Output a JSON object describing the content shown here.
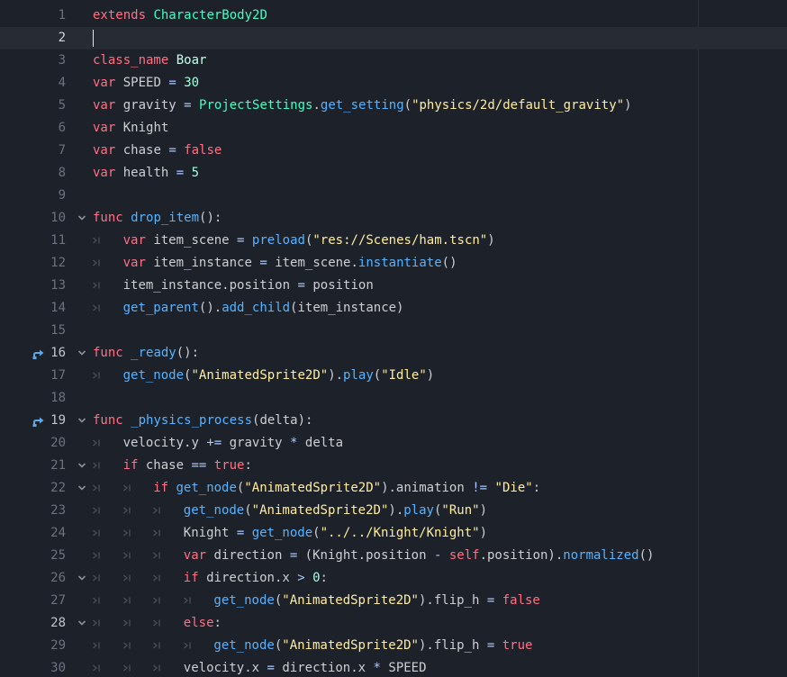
{
  "editor": {
    "current_line": 2,
    "line_numbers": [
      "1",
      "2",
      "3",
      "4",
      "5",
      "6",
      "7",
      "8",
      "9",
      "10",
      "11",
      "12",
      "13",
      "14",
      "15",
      "16",
      "17",
      "18",
      "19",
      "20",
      "21",
      "22",
      "23",
      "24",
      "25",
      "26",
      "27",
      "28",
      "29",
      "30"
    ],
    "lines": [
      {
        "indent": 0,
        "tokens": [
          [
            "kw",
            "extends"
          ],
          [
            "pl",
            " "
          ],
          [
            "ty",
            "CharacterBody2D"
          ]
        ]
      },
      {
        "indent": 0,
        "tokens": []
      },
      {
        "indent": 0,
        "tokens": [
          [
            "kw",
            "class_name"
          ],
          [
            "pl",
            " "
          ],
          [
            "cls",
            "Boar"
          ]
        ]
      },
      {
        "indent": 0,
        "tokens": [
          [
            "kw",
            "var"
          ],
          [
            "pl",
            " SPEED "
          ],
          [
            "op",
            "="
          ],
          [
            "pl",
            " "
          ],
          [
            "nu",
            "30"
          ]
        ]
      },
      {
        "indent": 0,
        "tokens": [
          [
            "kw",
            "var"
          ],
          [
            "pl",
            " gravity "
          ],
          [
            "op",
            "="
          ],
          [
            "pl",
            " "
          ],
          [
            "ty",
            "ProjectSettings"
          ],
          [
            "pl",
            "."
          ],
          [
            "fn",
            "get_setting"
          ],
          [
            "pl",
            "("
          ],
          [
            "st",
            "\"physics/2d/default_gravity\""
          ],
          [
            "pl",
            ")"
          ]
        ]
      },
      {
        "indent": 0,
        "tokens": [
          [
            "kw",
            "var"
          ],
          [
            "pl",
            " Knight"
          ]
        ]
      },
      {
        "indent": 0,
        "tokens": [
          [
            "kw",
            "var"
          ],
          [
            "pl",
            " chase "
          ],
          [
            "op",
            "="
          ],
          [
            "pl",
            " "
          ],
          [
            "kw",
            "false"
          ]
        ]
      },
      {
        "indent": 0,
        "tokens": [
          [
            "kw",
            "var"
          ],
          [
            "pl",
            " health "
          ],
          [
            "op",
            "="
          ],
          [
            "pl",
            " "
          ],
          [
            "nu",
            "5"
          ]
        ]
      },
      {
        "indent": 0,
        "tokens": []
      },
      {
        "indent": 0,
        "tokens": [
          [
            "kw",
            "func"
          ],
          [
            "pl",
            " "
          ],
          [
            "fn",
            "drop_item"
          ],
          [
            "pl",
            "():"
          ]
        ]
      },
      {
        "indent": 1,
        "tokens": [
          [
            "kw",
            "var"
          ],
          [
            "pl",
            " item_scene "
          ],
          [
            "op",
            "="
          ],
          [
            "pl",
            " "
          ],
          [
            "fn",
            "preload"
          ],
          [
            "pl",
            "("
          ],
          [
            "st",
            "\"res://Scenes/ham.tscn\""
          ],
          [
            "pl",
            ")"
          ]
        ]
      },
      {
        "indent": 1,
        "tokens": [
          [
            "kw",
            "var"
          ],
          [
            "pl",
            " item_instance "
          ],
          [
            "op",
            "="
          ],
          [
            "pl",
            " item_scene."
          ],
          [
            "fn",
            "instantiate"
          ],
          [
            "pl",
            "()"
          ]
        ]
      },
      {
        "indent": 1,
        "tokens": [
          [
            "pl",
            "item_instance.position "
          ],
          [
            "op",
            "="
          ],
          [
            "pl",
            " position"
          ]
        ]
      },
      {
        "indent": 1,
        "tokens": [
          [
            "fn",
            "get_parent"
          ],
          [
            "pl",
            "()."
          ],
          [
            "fn",
            "add_child"
          ],
          [
            "pl",
            "(item_instance)"
          ]
        ]
      },
      {
        "indent": 0,
        "tokens": []
      },
      {
        "indent": 0,
        "tokens": [
          [
            "kw",
            "func"
          ],
          [
            "pl",
            " "
          ],
          [
            "fn",
            "_ready"
          ],
          [
            "pl",
            "():"
          ]
        ]
      },
      {
        "indent": 1,
        "tokens": [
          [
            "fn",
            "get_node"
          ],
          [
            "pl",
            "("
          ],
          [
            "st",
            "\"AnimatedSprite2D\""
          ],
          [
            "pl",
            ")."
          ],
          [
            "fn",
            "play"
          ],
          [
            "pl",
            "("
          ],
          [
            "st",
            "\"Idle\""
          ],
          [
            "pl",
            ")"
          ]
        ]
      },
      {
        "indent": 0,
        "tokens": []
      },
      {
        "indent": 0,
        "tokens": [
          [
            "kw",
            "func"
          ],
          [
            "pl",
            " "
          ],
          [
            "fn",
            "_physics_process"
          ],
          [
            "pl",
            "(delta):"
          ]
        ]
      },
      {
        "indent": 1,
        "tokens": [
          [
            "pl",
            "velocity.y "
          ],
          [
            "op",
            "+="
          ],
          [
            "pl",
            " gravity "
          ],
          [
            "op",
            "*"
          ],
          [
            "pl",
            " delta"
          ]
        ]
      },
      {
        "indent": 1,
        "tokens": [
          [
            "kw",
            "if"
          ],
          [
            "pl",
            " chase "
          ],
          [
            "op",
            "=="
          ],
          [
            "pl",
            " "
          ],
          [
            "kw",
            "true"
          ],
          [
            "pl",
            ":"
          ]
        ]
      },
      {
        "indent": 2,
        "tokens": [
          [
            "kw",
            "if"
          ],
          [
            "pl",
            " "
          ],
          [
            "fn",
            "get_node"
          ],
          [
            "pl",
            "("
          ],
          [
            "st",
            "\"AnimatedSprite2D\""
          ],
          [
            "pl",
            ").animation "
          ],
          [
            "op",
            "!="
          ],
          [
            "pl",
            " "
          ],
          [
            "st",
            "\"Die\""
          ],
          [
            "pl",
            ":"
          ]
        ]
      },
      {
        "indent": 3,
        "tokens": [
          [
            "fn",
            "get_node"
          ],
          [
            "pl",
            "("
          ],
          [
            "st",
            "\"AnimatedSprite2D\""
          ],
          [
            "pl",
            ")."
          ],
          [
            "fn",
            "play"
          ],
          [
            "pl",
            "("
          ],
          [
            "st",
            "\"Run\""
          ],
          [
            "pl",
            ")"
          ]
        ]
      },
      {
        "indent": 3,
        "tokens": [
          [
            "pl",
            "Knight "
          ],
          [
            "op",
            "="
          ],
          [
            "pl",
            " "
          ],
          [
            "fn",
            "get_node"
          ],
          [
            "pl",
            "("
          ],
          [
            "st",
            "\"../../Knight/Knight\""
          ],
          [
            "pl",
            ")"
          ]
        ]
      },
      {
        "indent": 3,
        "tokens": [
          [
            "kw",
            "var"
          ],
          [
            "pl",
            " direction "
          ],
          [
            "op",
            "="
          ],
          [
            "pl",
            " (Knight.position "
          ],
          [
            "op",
            "-"
          ],
          [
            "pl",
            " "
          ],
          [
            "kw",
            "self"
          ],
          [
            "pl",
            ".position)."
          ],
          [
            "fn",
            "normalized"
          ],
          [
            "pl",
            "()"
          ]
        ]
      },
      {
        "indent": 3,
        "tokens": [
          [
            "kw",
            "if"
          ],
          [
            "pl",
            " direction.x "
          ],
          [
            "op",
            ">"
          ],
          [
            "pl",
            " "
          ],
          [
            "nu",
            "0"
          ],
          [
            "pl",
            ":"
          ]
        ]
      },
      {
        "indent": 4,
        "tokens": [
          [
            "fn",
            "get_node"
          ],
          [
            "pl",
            "("
          ],
          [
            "st",
            "\"AnimatedSprite2D\""
          ],
          [
            "pl",
            ").flip_h "
          ],
          [
            "op",
            "="
          ],
          [
            "pl",
            " "
          ],
          [
            "kw",
            "false"
          ]
        ]
      },
      {
        "indent": 3,
        "tokens": [
          [
            "kw",
            "else"
          ],
          [
            "pl",
            ":"
          ]
        ]
      },
      {
        "indent": 4,
        "tokens": [
          [
            "fn",
            "get_node"
          ],
          [
            "pl",
            "("
          ],
          [
            "st",
            "\"AnimatedSprite2D\""
          ],
          [
            "pl",
            ").flip_h "
          ],
          [
            "op",
            "="
          ],
          [
            "pl",
            " "
          ],
          [
            "kw",
            "true"
          ]
        ]
      },
      {
        "indent": 3,
        "tokens": [
          [
            "pl",
            "velocity.x "
          ],
          [
            "op",
            "="
          ],
          [
            "pl",
            " direction.x "
          ],
          [
            "op",
            "*"
          ],
          [
            "pl",
            " SPEED"
          ]
        ]
      }
    ],
    "fold_lines": [
      10,
      16,
      19,
      21,
      22,
      26,
      28
    ],
    "override_lines": [
      16,
      19
    ],
    "bright_number_lines": [
      16,
      19,
      28
    ],
    "icons": {
      "fold": "chevron-down-icon",
      "override": "method-override-icon",
      "tab": "tab-indent-icon"
    },
    "colors": {
      "background": "#1d2129",
      "current_line": "#272b33",
      "keyword": "#ff7085",
      "type": "#42ffc2",
      "class": "#c7ffed",
      "function": "#57b3ff",
      "string": "#ffeda1",
      "number": "#a1ffe0",
      "text": "#cdcfd2",
      "operator": "#abc9ff",
      "override_icon": "#5fa8e6",
      "line_number": "#6b7280"
    }
  }
}
